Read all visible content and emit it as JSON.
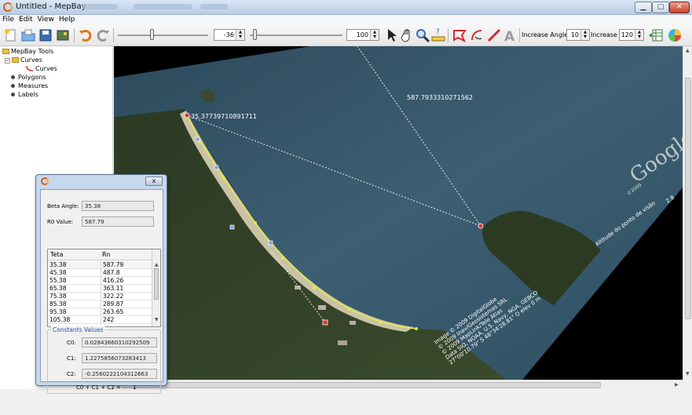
{
  "window": {
    "title": "Untitled - MepBay",
    "controls": [
      "minimize",
      "maximize",
      "close"
    ]
  },
  "menu": [
    "File",
    "Edit",
    "View",
    "Help"
  ],
  "toolbar": {
    "angle_value": "-36",
    "zoom_value": "100",
    "increase_angle_label": "Increase Angle",
    "increase_angle_value": "10",
    "increase_limit_label": "Increase Limit",
    "increase_limit_value": "120"
  },
  "tree": {
    "root": "MepBay Tools",
    "curves_folder": "Curves",
    "curves_item": "Curves",
    "polygons": "Polygons",
    "measures": "Measures",
    "labels": "Labels"
  },
  "map": {
    "label_angle": "35.37739710891711",
    "label_distance": "587.7933310271562",
    "watermark": "Google",
    "attribution": "Image © 2009 DigitalGlobe\n© 2009 Inav/Geosistemas SRL\n© 2009 MapLink/Tele Atlas\nData SIO, NOAA, U.S. Navy, NGA, GEBCO\n27°00'10.79\" S  48°34'28.81\" O  elev 0 m",
    "altitude_text": "Altitude do ponto de visão",
    "altitude_value": "2.8",
    "year_text": "©2009",
    "accent_color": "#e8e84a",
    "marker_color": "#e03030"
  },
  "dialog": {
    "beta_angle_label": "Beta Angle:",
    "beta_angle_value": "35.38",
    "r0_label": "R0 Value:",
    "r0_value": "587.79",
    "table_headers": [
      "Teta",
      "Rn"
    ],
    "rows": [
      [
        "35.38",
        "587.79"
      ],
      [
        "45.38",
        "487.8"
      ],
      [
        "55.38",
        "416.26"
      ],
      [
        "65.38",
        "363.11"
      ],
      [
        "75.38",
        "322.22"
      ],
      [
        "85.38",
        "289.87"
      ],
      [
        "95.38",
        "263.65"
      ],
      [
        "105.38",
        "242"
      ]
    ],
    "constants_title": "Constants Values",
    "c0_label": "C0:",
    "c0_value": "0.02843660310292509",
    "c1_label": "C1:",
    "c1_value": "1.2275856073283413",
    "c2_label": "C2:",
    "c2_value": "-0.2560222104312663",
    "sum_label": "C0 + C1 + C2 =",
    "sum_value": "1"
  }
}
